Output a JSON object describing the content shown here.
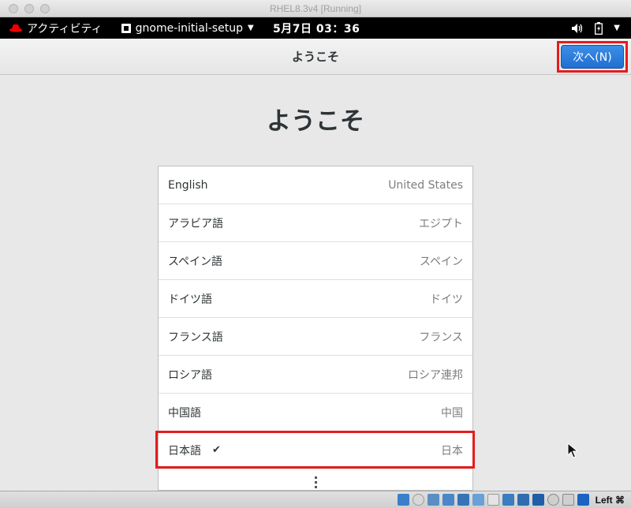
{
  "window": {
    "title": "RHEL8.3v4 [Running]"
  },
  "gnome_bar": {
    "activities_label": "アクティビティ",
    "app_name": "gnome-initial-setup",
    "clock": "5月7日  03：36"
  },
  "header": {
    "title": "ようこそ",
    "next_label": "次へ(N)"
  },
  "main": {
    "title": "ようこそ",
    "languages": [
      {
        "name": "English",
        "region": "United States",
        "selected": false
      },
      {
        "name": "アラビア語",
        "region": "エジプト",
        "selected": false
      },
      {
        "name": "スペイン語",
        "region": "スペイン",
        "selected": false
      },
      {
        "name": "ドイツ語",
        "region": "ドイツ",
        "selected": false
      },
      {
        "name": "フランス語",
        "region": "フランス",
        "selected": false
      },
      {
        "name": "ロシア語",
        "region": "ロシア連邦",
        "selected": false
      },
      {
        "name": "中国語",
        "region": "中国",
        "selected": false
      },
      {
        "name": "日本語",
        "region": "日本",
        "selected": true
      }
    ],
    "check_mark": "✔"
  },
  "statusbar": {
    "host_key": "Left ⌘"
  },
  "colors": {
    "accent": "#1f6fd1",
    "highlight": "#e51c1c"
  }
}
